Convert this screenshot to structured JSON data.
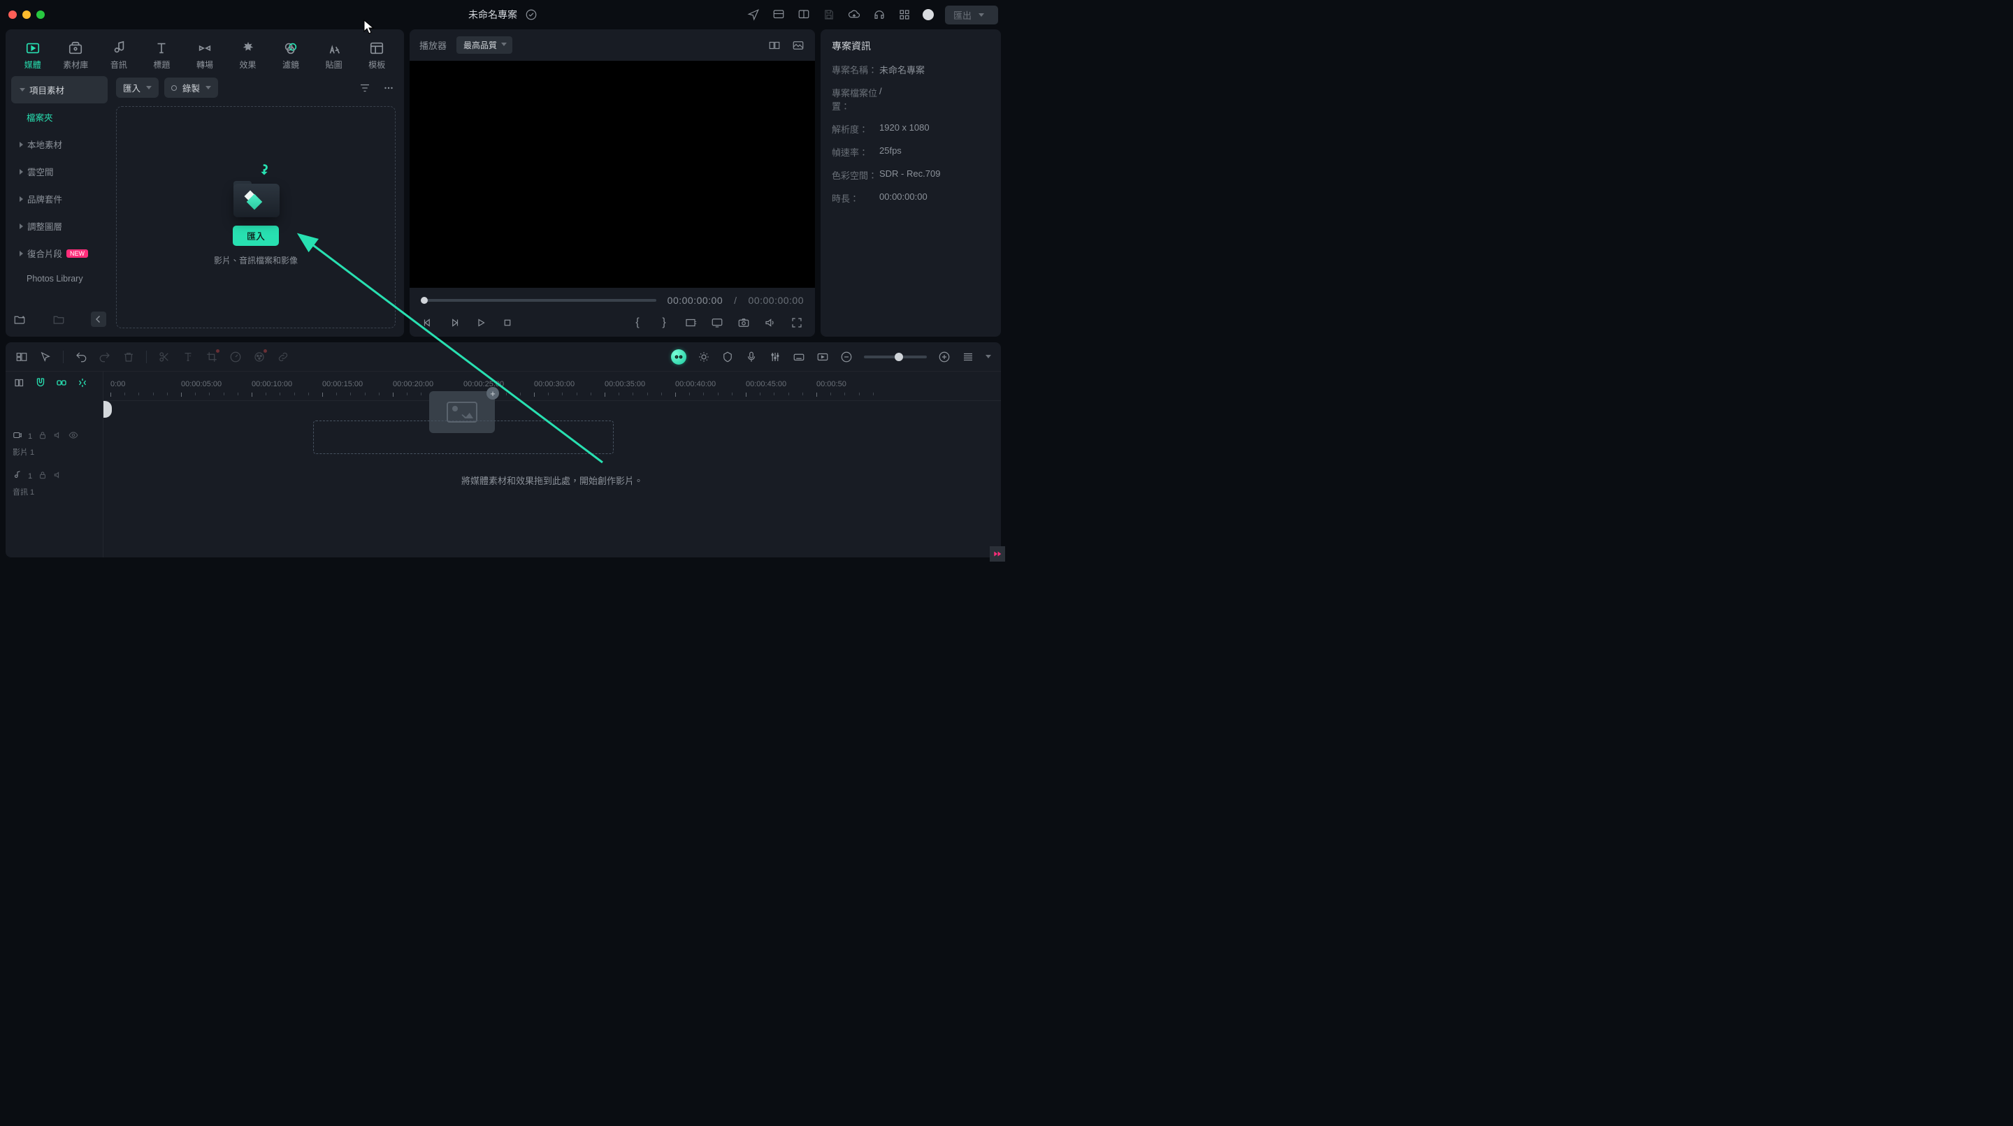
{
  "title": "未命名專案",
  "export_label": "匯出",
  "tabs": {
    "media": "媒體",
    "stock": "素材庫",
    "audio": "音訊",
    "title": "標題",
    "transition": "轉場",
    "effect": "效果",
    "filter": "濾鏡",
    "sticker": "貼圖",
    "template": "模板"
  },
  "media_toolbar": {
    "import": "匯入",
    "record": "錄製"
  },
  "sidebar": {
    "items": [
      {
        "label": "項目素材"
      },
      {
        "label": "檔案夾"
      },
      {
        "label": "本地素材"
      },
      {
        "label": "雲空間"
      },
      {
        "label": "品牌套件"
      },
      {
        "label": "調整圖層"
      },
      {
        "label": "復合片段",
        "badge": "NEW"
      },
      {
        "label": "Photos Library"
      }
    ]
  },
  "dropzone": {
    "button": "匯入",
    "hint": "影片、音訊檔案和影像"
  },
  "preview": {
    "title": "播放器",
    "quality": "最高品質",
    "current": "00:00:00:00",
    "duration": "00:00:00:00",
    "sep": "/"
  },
  "timeline": {
    "ruler": [
      "0:00",
      "00:00:05:00",
      "00:00:10:00",
      "00:00:15:00",
      "00:00:20:00",
      "00:00:25:00",
      "00:00:30:00",
      "00:00:35:00",
      "00:00:40:00",
      "00:00:45:00",
      "00:00:50"
    ],
    "hint": "將媒體素材和效果拖到此處，開始創作影片。",
    "track_video_short": "1",
    "track_video_label": "影片 1",
    "track_audio_short": "1",
    "track_audio_label": "音訊 1"
  },
  "info": {
    "panel_title": "專案資訊",
    "rows": [
      {
        "k": "專案名稱：",
        "v": "未命名專案"
      },
      {
        "k": "專案檔案位置：",
        "v": "/"
      },
      {
        "k": "解析度：",
        "v": "1920 x 1080"
      },
      {
        "k": "幀速率：",
        "v": "25fps"
      },
      {
        "k": "色彩空間：",
        "v": "SDR - Rec.709"
      },
      {
        "k": "時長：",
        "v": "00:00:00:00"
      }
    ]
  }
}
